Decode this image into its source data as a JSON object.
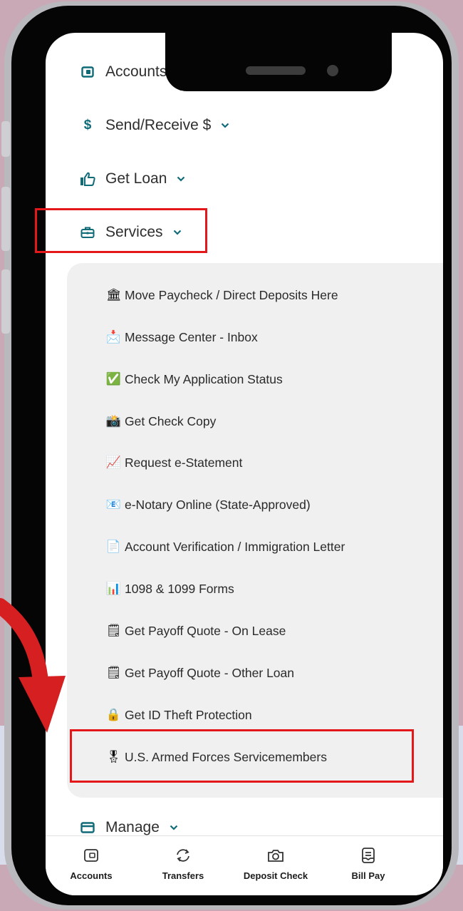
{
  "menu": {
    "items": [
      {
        "label": "Accounts",
        "icon": "wallet-icon"
      },
      {
        "label": "Send/Receive $",
        "icon": "dollar-icon"
      },
      {
        "label": "Get Loan",
        "icon": "thumbs-up-icon"
      },
      {
        "label": "Services",
        "icon": "briefcase-icon"
      },
      {
        "label": "Manage",
        "icon": "card-icon"
      }
    ]
  },
  "services": {
    "items": [
      {
        "emoji": "🏛",
        "label": "Move Paycheck / Direct Deposits Here"
      },
      {
        "emoji": "📩",
        "label": "Message Center - Inbox"
      },
      {
        "emoji": "✅",
        "label": "Check My Application Status"
      },
      {
        "emoji": "📸",
        "label": "Get Check Copy"
      },
      {
        "emoji": "📈",
        "label": "Request e-Statement"
      },
      {
        "emoji": "📧",
        "label": "e-Notary Online (State-Approved)"
      },
      {
        "emoji": "📄",
        "label": "Account Verification / Immigration Letter"
      },
      {
        "emoji": "📊",
        "label": "1098 & 1099 Forms"
      },
      {
        "emoji": "🗒",
        "label": "Get Payoff Quote - On Lease"
      },
      {
        "emoji": "🗒",
        "label": "Get Payoff Quote - Other Loan"
      },
      {
        "emoji": "🔒",
        "label": "Get ID Theft Protection"
      },
      {
        "emoji": "🎖",
        "label": "U.S. Armed Forces Servicemembers"
      }
    ]
  },
  "bottom_nav": {
    "tabs": [
      {
        "label": "Accounts",
        "icon": "wallet-icon"
      },
      {
        "label": "Transfers",
        "icon": "transfer-icon"
      },
      {
        "label": "Deposit Check",
        "icon": "camera-icon"
      },
      {
        "label": "Bill Pay",
        "icon": "bill-icon"
      }
    ]
  },
  "colors": {
    "accent": "#0f6b78",
    "highlight": "#e4171b",
    "background": "#c9a9b5",
    "submenu_bg": "#f0f0f0"
  }
}
